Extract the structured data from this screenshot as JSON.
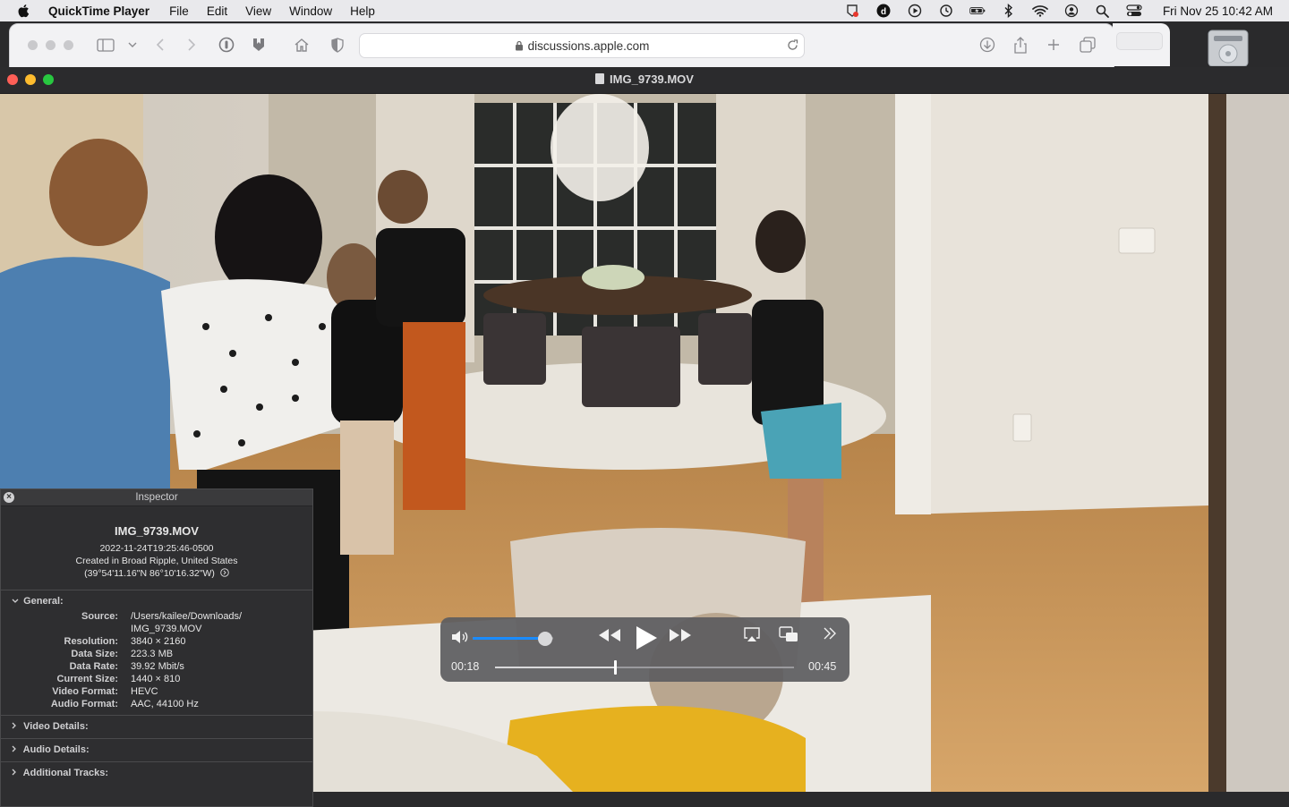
{
  "menubar": {
    "app_name": "QuickTime Player",
    "menus": [
      "File",
      "Edit",
      "View",
      "Window",
      "Help"
    ],
    "clock": "Fri Nov 25  10:42 AM"
  },
  "safari": {
    "url": "discussions.apple.com"
  },
  "window": {
    "title": "IMG_9739.MOV"
  },
  "controller": {
    "current_time": "00:18",
    "duration": "00:45",
    "volume_fraction": 0.9,
    "progress_fraction": 0.4
  },
  "inspector": {
    "title": "Inspector",
    "file_name": "IMG_9739.MOV",
    "date": "2022-11-24T19:25:46-0500",
    "location": "Created in Broad Ripple, United States",
    "coords": "(39°54'11.16\"N 86°10'16.32\"W)",
    "sections": {
      "general": "General:",
      "video": "Video Details:",
      "audio": "Audio Details:",
      "tracks": "Additional Tracks:"
    },
    "general": [
      {
        "k": "Source:",
        "v": "/Users/kailee/Downloads/ IMG_9739.MOV"
      },
      {
        "k": "Resolution:",
        "v": "3840 × 2160"
      },
      {
        "k": "Data Size:",
        "v": "223.3 MB"
      },
      {
        "k": "Data Rate:",
        "v": "39.92 Mbit/s"
      },
      {
        "k": "Current Size:",
        "v": "1440 × 810"
      },
      {
        "k": "Video Format:",
        "v": "HEVC"
      },
      {
        "k": "Audio Format:",
        "v": "AAC, 44100 Hz"
      }
    ]
  },
  "colors": {
    "accent": "#1a8cff",
    "close": "#ff5f57",
    "minimize": "#febc2e",
    "zoom": "#28c840"
  }
}
